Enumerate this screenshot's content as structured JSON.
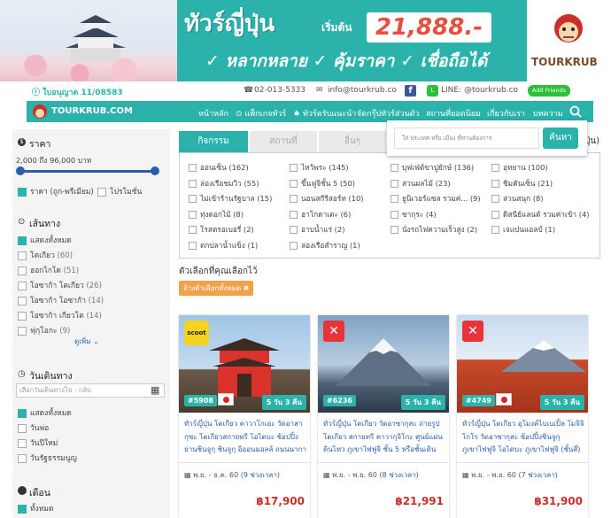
{
  "banner": {
    "headline": "ทัวร์ญี่ปุ่น",
    "starting": "เริ่มต้น",
    "price": "21,888.-",
    "features": "✓ หลากหลาย ✓ คุ้มราคา ✓ เชื่อถือได้",
    "logo_text": "TOURKRUB"
  },
  "infobar": {
    "license": "ใบอนุญาต 11/08583",
    "phone": "02-013-5333",
    "email": "info@tourkrub.co",
    "line": "LINE: @tourkrub.co",
    "add_friends": "Add Friends"
  },
  "nav": {
    "brand": "TOURKRUB.COM",
    "items": [
      "หน้าหลัก",
      "แพ็กเกจทัวร์",
      "ทัวร์ครับแนะนำ",
      "จัดกรุ๊ปทัวร์ส่วนตัว",
      "สถานที่ยอดนิยม",
      "เกี่ยวกับเรา",
      "บทความ"
    ]
  },
  "search": {
    "placeholder": "ใส่ ประเทศ หรือ เมือง ที่ท่านต้องการ",
    "button": "ค้นหา"
  },
  "sidebar": {
    "price_title": "ราคา",
    "price_range": "2,000 ถึง 96,000 บาท",
    "price_checks": [
      "ราคา (ถูก-พรีเมียม)",
      "โปรโมชั่น"
    ],
    "route_title": "เส้นทาง",
    "routes": [
      {
        "label": "แสดงทั้งหมด",
        "count": "",
        "checked": true
      },
      {
        "label": "โตเกียว",
        "count": "(60)",
        "checked": false
      },
      {
        "label": "ฮอกไกโด",
        "count": "(51)",
        "checked": false
      },
      {
        "label": "โอซาก้า โตเกียว",
        "count": "(26)",
        "checked": false
      },
      {
        "label": "โอซาก้า โอซาก้า",
        "count": "(14)",
        "checked": false
      },
      {
        "label": "โอซาก้า เกียวโต",
        "count": "(14)",
        "checked": false
      },
      {
        "label": "ฟุกุโอกะ",
        "count": "(9)",
        "checked": false
      }
    ],
    "see_more": "ดูเพิ่ม",
    "date_title": "วันเดินทาง",
    "date_placeholder": "เลือกวันเดินทางไป - กลับ",
    "dates": [
      {
        "label": "แสดงทั้งหมด",
        "checked": true
      },
      {
        "label": "วันพ่อ",
        "checked": false
      },
      {
        "label": "วันปีใหม่",
        "checked": false
      },
      {
        "label": "วันรัฐธรรมนูญ",
        "checked": false
      }
    ],
    "month_title": "เดือน",
    "months": [
      {
        "label": "ทั้งหมด",
        "checked": true
      }
    ]
  },
  "tabs": [
    "กิจกรรม",
    "สถานที่",
    "อื่นๆ"
  ],
  "activities": [
    [
      "ออนเซ็น (162)",
      "ไหว้พระ (145)",
      "บุฟเฟ่ต์ขาปูยักษ์ (136)",
      "อุทยาน (100)"
    ],
    [
      "ล่องเรือชมวิว (55)",
      "ขึ้นฟูจิชั้น 5 (50)",
      "สวนผลไม้ (23)",
      "ชิมคันเซ็น (21)"
    ],
    [
      "ไม่เข้าร้านรัฐบาล (15)",
      "นอนสกีรีสอร์ท (10)",
      "ยูนิเวอร์แซล รวมค่... (9)",
      "สวนสนุก (8)"
    ],
    [
      "ทุ่งดอกไม้ (8)",
      "ฮาโกดาเตะ (6)",
      "ซากุระ (4)",
      "ดิสนีย์แลนด์ รวมค่าเข้า (4)"
    ],
    [
      "โรสตรอเบอรี่ (2)",
      "อาบน้ำแร่ (2)",
      "นั่งรถไฟความเร็วสูง (2)",
      "เจแปนแอลป์ (1)"
    ],
    [
      "ตกปลาน้ำแข็ง (1)",
      "ล่องเรือสำราญ (1)",
      "",
      ""
    ]
  ],
  "selected_title": "ตัวเลือกที่คุณเลือกไว้",
  "clear_label": "ล้างตัวเลือกทั้งหมด",
  "cards": [
    {
      "airline": "scoot",
      "code": "#5908",
      "duration": "5 วัน 3 คืน",
      "description": "ทัวร์ญี่ปุ่น โตเกียว คาวาโกเอะ วัดอาสากุซะ โตเกียวสกายทรี โอไดบะ ช้อปปิ้งย่านชินจูกุ ชินจูกุ อิออนมอลล์ ถนนนากามิเสะ",
      "dates": "พ.ย. - ธ.ค. 60",
      "dates_more": "(9 ช่วงเวลา)",
      "price": "฿17,900"
    },
    {
      "airline": "airasia",
      "code": "#6236",
      "duration": "5 วัน 3 คืน",
      "description": "ทัวร์ญี่ปุ่น โตเกียว วัดอาซากุสะ ถ่ายรูปโตเกียว สกายทรี คาวากุจิโกะ ศูนย์แผ่นดินไหว ภูเขาไฟฟูจิ ชั้น 5 หรือชั้นเดิน",
      "dates": "พ.ย. - พ.ย. 60",
      "dates_more": "(8 ช่วงเวลา)",
      "price": "฿21,991"
    },
    {
      "airline": "airasia",
      "code": "#4749",
      "duration": "5 วัน 3 คืน",
      "description": "ทัวร์ญี่ปุ่น โตเกียว อุโมงค์ไบเบเปิ้ล โมจิจิโกโร วัดอาซากุสะ ช้อปปิ้งชินจูกุ ภูเขาไฟฟูจิ โอไดบะ ภูเขาไฟฟูจิ (ชั้นสี่)",
      "dates": "พ.ย. - พ.ย. 60",
      "dates_more": "(7 ช่วงเวลา)",
      "price": "฿31,900"
    }
  ],
  "colors": {
    "teal": "#2bb3ab",
    "red": "#c9302c",
    "link": "#2a5fa8",
    "orange": "#f0a24a"
  }
}
